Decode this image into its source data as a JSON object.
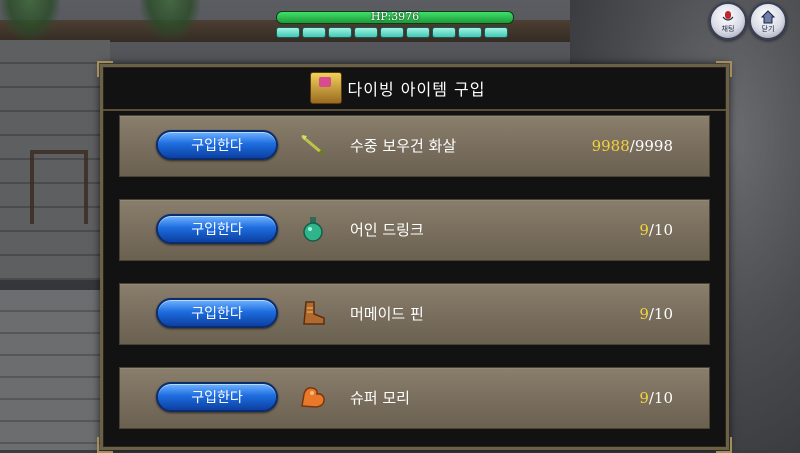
{
  "hud": {
    "hp_text": "HP:3976",
    "mp_segments": 9,
    "buttons": [
      {
        "label": "채팅",
        "icon": "chat-microphone-icon"
      },
      {
        "label": "닫기",
        "icon": "close-house-icon"
      }
    ]
  },
  "dialog": {
    "title": "다이빙 아이템 구입",
    "title_icon": "shop-chest-icon"
  },
  "items": [
    {
      "button_label": "구입한다",
      "icon": "arrow-icon",
      "name": "수중 보우건 화살",
      "current": "9988",
      "max": "/9998"
    },
    {
      "button_label": "구입한다",
      "icon": "potion-icon",
      "name": "어인 드링크",
      "current": "9",
      "max": "/10"
    },
    {
      "button_label": "구입한다",
      "icon": "boot-icon",
      "name": "머메이드 핀",
      "current": "9",
      "max": "/10"
    },
    {
      "button_label": "구입한다",
      "icon": "muscle-arm-icon",
      "name": "슈퍼 모리",
      "current": "9",
      "max": "/10"
    }
  ],
  "colors": {
    "count_current": "#f2d23c",
    "button_blue": "#1d6de0",
    "row_bg": "#7a6f5e"
  }
}
